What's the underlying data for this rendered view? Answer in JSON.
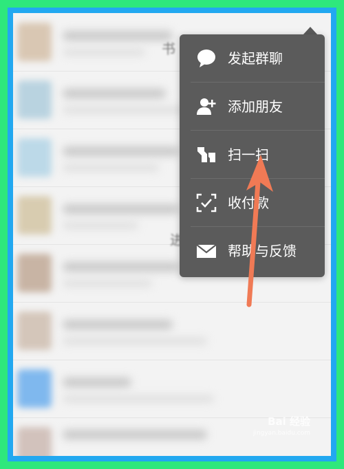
{
  "colors": {
    "outer_border": "#2ee87c",
    "inner_border": "#22a8f0",
    "menu_bg": "#5b5b5b",
    "menu_text": "#ffffff",
    "annotation_arrow": "#f07a55"
  },
  "background": {
    "ghost_texts": [
      "书",
      "进"
    ]
  },
  "popup_menu": {
    "items": [
      {
        "label": "发起群聊",
        "icon": "chat-bubble-icon"
      },
      {
        "label": "添加朋友",
        "icon": "add-friend-icon"
      },
      {
        "label": "扫一扫",
        "icon": "scan-icon"
      },
      {
        "label": "收付款",
        "icon": "payment-scan-icon"
      },
      {
        "label": "帮助与反馈",
        "icon": "envelope-icon"
      }
    ]
  },
  "annotation": {
    "points_to": "扫一扫",
    "icon": "arrow-up-icon"
  },
  "watermark": {
    "text": "Bai 经验",
    "url_text": "jingyan.baidu.com"
  }
}
